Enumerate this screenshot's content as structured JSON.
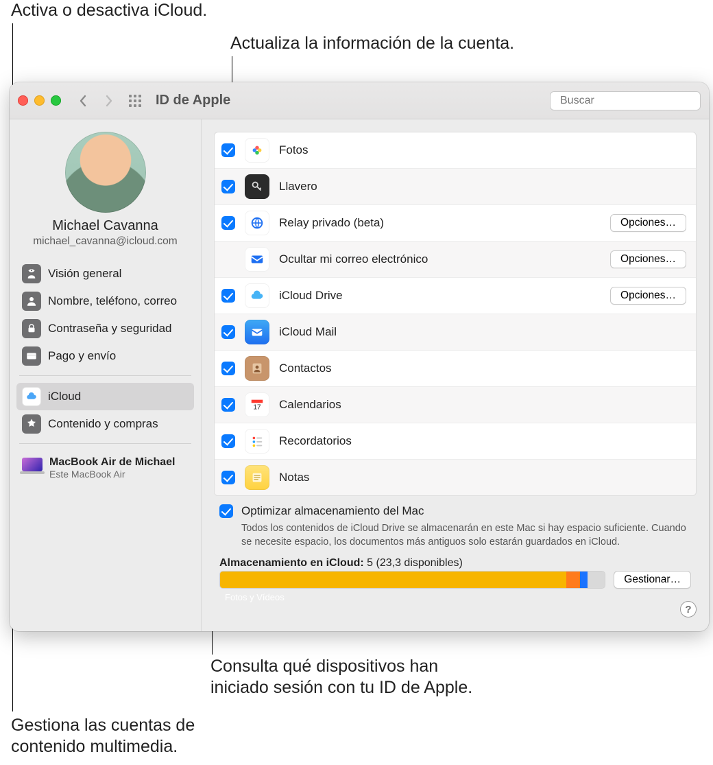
{
  "callouts": {
    "top_left": "Activa o desactiva iCloud.",
    "top_right": "Actualiza la información de la cuenta.",
    "bottom_right": "Consulta qué dispositivos han\niniciado sesión con tu ID de Apple.",
    "bottom_left": "Gestiona las cuentas de\ncontenido multimedia."
  },
  "toolbar": {
    "title": "ID de Apple",
    "search_placeholder": "Buscar"
  },
  "profile": {
    "name": "Michael Cavanna",
    "email": "michael_cavanna@icloud.com"
  },
  "sidebar": {
    "items": [
      {
        "id": "overview",
        "label": "Visión general"
      },
      {
        "id": "name",
        "label": "Nombre, teléfono, correo"
      },
      {
        "id": "security",
        "label": "Contraseña y seguridad"
      },
      {
        "id": "payment",
        "label": "Pago y envío"
      }
    ],
    "items2": [
      {
        "id": "icloud",
        "label": "iCloud",
        "selected": true
      },
      {
        "id": "media",
        "label": "Contenido y compras"
      }
    ],
    "device": {
      "title": "MacBook Air de Michael",
      "subtitle": "Este MacBook Air"
    }
  },
  "services": [
    {
      "id": "photos",
      "label": "Fotos",
      "checked": true
    },
    {
      "id": "keychain",
      "label": "Llavero",
      "checked": true
    },
    {
      "id": "relay",
      "label": "Relay privado (beta)",
      "checked": true,
      "options": true
    },
    {
      "id": "hidemail",
      "label": "Ocultar mi correo electrónico",
      "checked": null,
      "options": true
    },
    {
      "id": "drive",
      "label": "iCloud Drive",
      "checked": true,
      "options": true
    },
    {
      "id": "mail",
      "label": "iCloud Mail",
      "checked": true
    },
    {
      "id": "contacts",
      "label": "Contactos",
      "checked": true
    },
    {
      "id": "calendar",
      "label": "Calendarios",
      "checked": true
    },
    {
      "id": "reminders",
      "label": "Recordatorios",
      "checked": true
    },
    {
      "id": "notes",
      "label": "Notas",
      "checked": true
    }
  ],
  "options_label": "Opciones…",
  "optimize": {
    "checked": true,
    "label": "Optimizar almacenamiento del Mac",
    "desc": "Todos los contenidos de iCloud Drive se almacenarán en este Mac si hay espacio suficiente. Cuando se necesite espacio, los documentos más antiguos solo estarán guardados en iCloud."
  },
  "storage": {
    "label_prefix": "Almacenamiento en iCloud:",
    "label_value": "5 (23,3 disponibles)",
    "segments": [
      {
        "label": "Fotos y Vídeos",
        "color": "#f7b500",
        "pct": 90
      },
      {
        "label": "",
        "color": "#ff7b1c",
        "pct": 3.5
      },
      {
        "label": "",
        "color": "#1a73ff",
        "pct": 2
      },
      {
        "label": "",
        "color": "#d9d9d9",
        "pct": 4.5
      }
    ],
    "manage_label": "Gestionar…"
  },
  "help_label": "?"
}
